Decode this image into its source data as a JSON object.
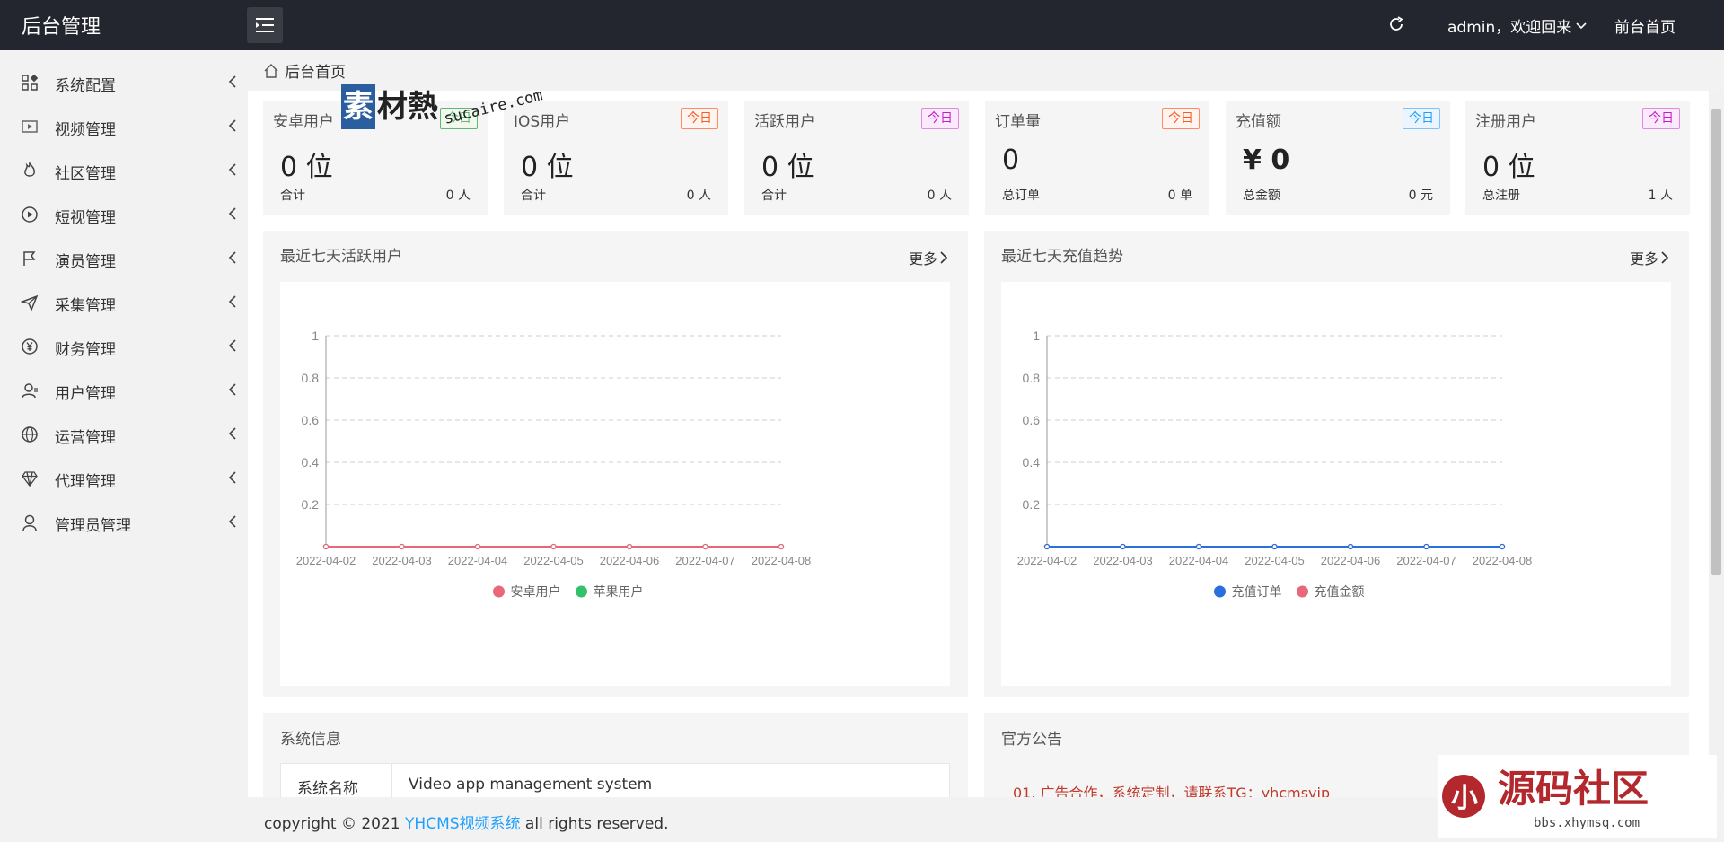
{
  "header": {
    "brand": "后台管理",
    "user": "admin，欢迎回来",
    "front_link": "前台首页"
  },
  "sidebar": {
    "items": [
      {
        "label": "系统配置",
        "icon": "grid-icon"
      },
      {
        "label": "视频管理",
        "icon": "video-icon"
      },
      {
        "label": "社区管理",
        "icon": "fire-icon"
      },
      {
        "label": "短视管理",
        "icon": "play-circle-icon"
      },
      {
        "label": "演员管理",
        "icon": "flag-icon"
      },
      {
        "label": "采集管理",
        "icon": "send-icon"
      },
      {
        "label": "财务管理",
        "icon": "yen-icon"
      },
      {
        "label": "用户管理",
        "icon": "user-card-icon"
      },
      {
        "label": "运营管理",
        "icon": "globe-icon"
      },
      {
        "label": "代理管理",
        "icon": "diamond-icon"
      },
      {
        "label": "管理员管理",
        "icon": "person-icon"
      }
    ]
  },
  "breadcrumb": {
    "label": "后台首页"
  },
  "stats": [
    {
      "title": "安卓用户",
      "badge": "今日",
      "value": "0 位",
      "left_label": "合计",
      "right_value": "0 人",
      "badge_color": "#5fb878"
    },
    {
      "title": "IOS用户",
      "badge": "今日",
      "value": "0 位",
      "left_label": "合计",
      "right_value": "0 人",
      "badge_color": "#ff5722"
    },
    {
      "title": "活跃用户",
      "badge": "今日",
      "value": "0 位",
      "left_label": "合计",
      "right_value": "0 人",
      "badge_color": "#c71bc7"
    },
    {
      "title": "订单量",
      "badge": "今日",
      "value": "0",
      "left_label": "总订单",
      "right_value": "0 单",
      "badge_color": "#ff5722"
    },
    {
      "title": "充值额",
      "badge": "今日",
      "value_prefix": "¥",
      "value": "0",
      "left_label": "总金额",
      "right_value": "0 元",
      "badge_color": "#1e9fff"
    },
    {
      "title": "注册用户",
      "badge": "今日",
      "value": "0 位",
      "left_label": "总注册",
      "right_value": "1 人",
      "badge_color": "#c71bc7"
    }
  ],
  "charts": {
    "active": {
      "title": "最近七天活跃用户",
      "more": "更多"
    },
    "recharge": {
      "title": "最近七天充值趋势",
      "more": "更多"
    }
  },
  "chart_data": [
    {
      "type": "line",
      "x": [
        "2022-04-02",
        "2022-04-03",
        "2022-04-04",
        "2022-04-05",
        "2022-04-06",
        "2022-04-07",
        "2022-04-08"
      ],
      "series": [
        {
          "name": "安卓用户",
          "values": [
            0,
            0,
            0,
            0,
            0,
            0,
            0
          ],
          "color": "#e8677a"
        },
        {
          "name": "苹果用户",
          "values": [
            0,
            0,
            0,
            0,
            0,
            0,
            0
          ],
          "color": "#33c16b"
        }
      ],
      "yticks": [
        "1",
        "0.8",
        "0.6",
        "0.4",
        "0.2"
      ],
      "ylim": [
        0,
        1
      ],
      "grid": true,
      "legend": "bottom"
    },
    {
      "type": "line",
      "x": [
        "2022-04-02",
        "2022-04-03",
        "2022-04-04",
        "2022-04-05",
        "2022-04-06",
        "2022-04-07",
        "2022-04-08"
      ],
      "series": [
        {
          "name": "充值订单",
          "values": [
            0,
            0,
            0,
            0,
            0,
            0,
            0
          ],
          "color": "#2a6fdb"
        },
        {
          "name": "充值金额",
          "values": [
            0,
            0,
            0,
            0,
            0,
            0,
            0
          ],
          "color": "#e8677a"
        }
      ],
      "yticks": [
        "1",
        "0.8",
        "0.6",
        "0.4",
        "0.2"
      ],
      "ylim": [
        0,
        1
      ],
      "grid": true,
      "legend": "bottom"
    }
  ],
  "system_info": {
    "title": "系统信息",
    "rows": [
      {
        "key": "系统名称",
        "value": "Video app management system"
      }
    ]
  },
  "announcement": {
    "title": "官方公告",
    "text": "01. 广告合作，系统定制，请联系TG：yhcmsvip"
  },
  "footer": {
    "prefix": "copyright © 2021 ",
    "link": "YHCMS视频系统",
    "suffix": " all rights reserved."
  },
  "watermarks": {
    "top": "素材熱",
    "top_url": "sucaire.com",
    "bottom": "源码社区",
    "bottom_url": "bbs.xhymsq.com"
  }
}
